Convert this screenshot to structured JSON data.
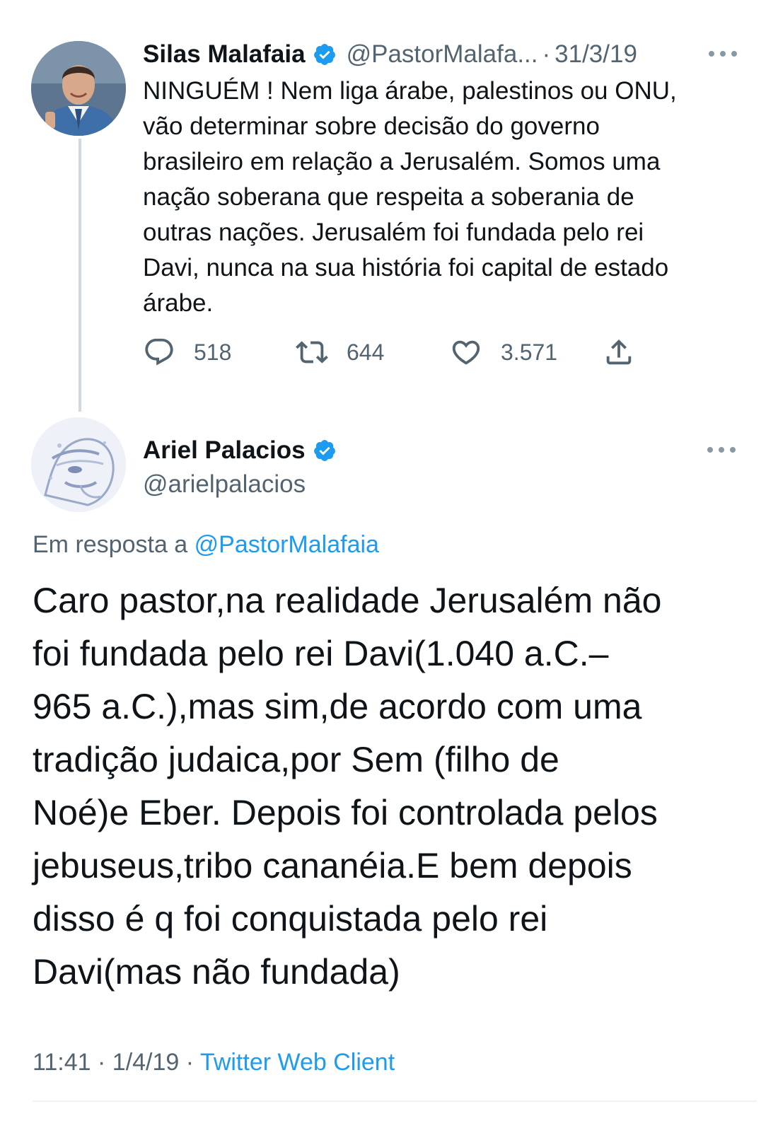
{
  "parent_tweet": {
    "author_name": "Silas Malafaia",
    "author_handle": "@PastorMalafa...",
    "separator": "·",
    "date": "31/3/19",
    "text": "NINGUÉM ! Nem liga árabe, palestinos ou ONU,\nvão determinar sobre decisão do governo\nbrasileiro em relação a Jerusalém. Somos uma\nnação soberana que respeita a soberania de\noutras nações. Jerusalém foi fundada pelo rei\nDavi, nunca na sua história foi capital de estado\nárabe.",
    "replies_count": "518",
    "retweets_count": "644",
    "likes_count": "3.571",
    "verified": true
  },
  "reply_tweet": {
    "author_name": "Ariel Palacios",
    "author_handle": "@arielpalacios",
    "verified": true,
    "reply_to_prefix": "Em resposta a ",
    "reply_to_handle": "@PastorMalafaia",
    "text": "Caro pastor,na realidade Jerusalém não\nfoi fundada pelo rei Davi(1.040 a.C.–\n965 a.C.),mas sim,de acordo com uma\ntradição judaica,por Sem (filho de\nNoé)e Eber. Depois foi controlada pelos\njebuseus,tribo cananéia.E bem depois\ndisso é q foi conquistada pelo rei\nDavi(mas não fundada)",
    "time": "11:41",
    "meta_separator": " · ",
    "date": "1/4/19",
    "source": "Twitter Web Client"
  },
  "icons": {
    "verified": "verified-badge-icon",
    "more": "more-dots-icon",
    "reply": "reply-icon",
    "retweet": "retweet-icon",
    "like": "like-icon",
    "share": "share-icon"
  },
  "colors": {
    "text": "#0f1419",
    "secondary": "#536471",
    "link": "#1d9bf0",
    "verified": "#1d9bf0",
    "thread_line": "#cfd9de"
  }
}
